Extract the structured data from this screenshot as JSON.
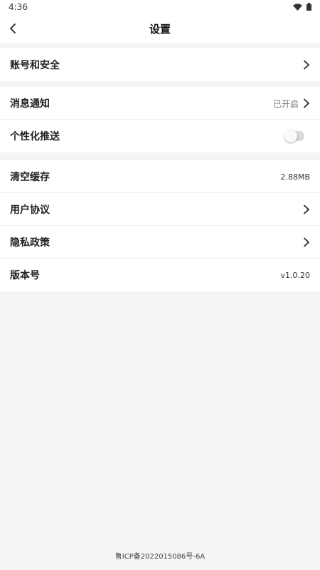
{
  "status_bar": {
    "time": "4:36",
    "icons": [
      "wifi-icon",
      "battery-icon"
    ]
  },
  "nav": {
    "back_icon": "chevron-left-icon",
    "title": "设置"
  },
  "groups": [
    {
      "items": [
        {
          "label": "账号和安全",
          "value": "",
          "control": "chevron-right-icon"
        }
      ]
    },
    {
      "items": [
        {
          "label": "消息通知",
          "value": "已开启",
          "control": "chevron-right-icon"
        },
        {
          "label": "个性化推送",
          "value": "",
          "control": "toggle",
          "toggle_on": false
        }
      ]
    },
    {
      "items": [
        {
          "label": "清空缓存",
          "value": "2.88MB",
          "control": "none"
        },
        {
          "label": "用户协议",
          "value": "",
          "control": "chevron-right-icon"
        },
        {
          "label": "隐私政策",
          "value": "",
          "control": "chevron-right-icon"
        },
        {
          "label": "版本号",
          "value": "v1.0.20",
          "control": "none"
        }
      ]
    }
  ],
  "footer": {
    "icp": "鲁ICP备2022015086号-6A"
  },
  "colors": {
    "background": "#f5f5f7",
    "surface": "#ffffff",
    "text_primary": "#222222",
    "text_secondary": "#777777",
    "toggle_off_track": "#d9d9d9"
  }
}
